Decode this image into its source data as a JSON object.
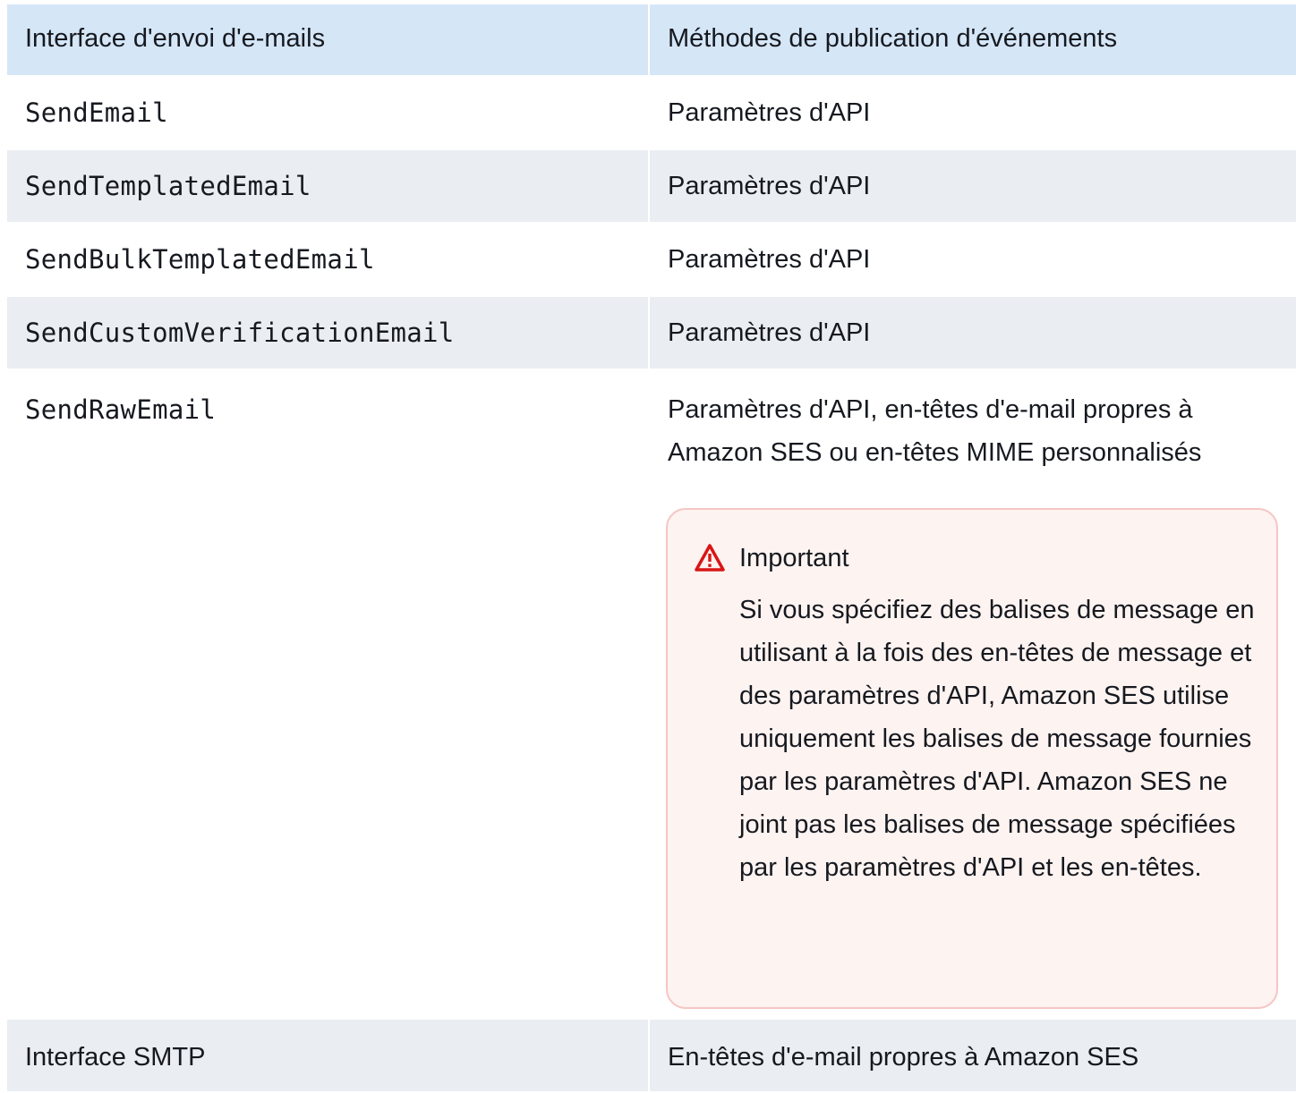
{
  "table": {
    "headers": [
      "Interface d'envoi d'e-mails",
      "Méthodes de publication d'événements"
    ],
    "rows": [
      {
        "interface": "SendEmail",
        "methods": "Paramètres d'API"
      },
      {
        "interface": "SendTemplatedEmail",
        "methods": "Paramètres d'API"
      },
      {
        "interface": "SendBulkTemplatedEmail",
        "methods": "Paramètres d'API"
      },
      {
        "interface": "SendCustomVerificationEmail",
        "methods": "Paramètres d'API"
      },
      {
        "interface": "SendRawEmail",
        "methods": "Paramètres d'API, en-têtes d'e-mail propres à Amazon SES ou en-têtes MIME personnalisés",
        "alert": {
          "icon": "warning-icon",
          "title": "Important",
          "text": "Si vous spécifiez des balises de message en utilisant à la fois des en-têtes de message et des paramètres d'API, Amazon SES utilise uniquement les balises de message fournies par les paramètres d'API. Amazon SES ne joint pas les balises de message spécifiées par les paramètres d'API et les en-têtes."
        }
      },
      {
        "interface": "Interface SMTP",
        "methods": "En-têtes d'e-mail propres à Amazon SES"
      }
    ]
  },
  "colors": {
    "header_bg": "#d5e6f7",
    "row_alt_bg": "#eaedf1",
    "alert_bg": "#fdf3f1",
    "alert_border": "#f5c6c4",
    "warning_red": "#d91515"
  }
}
